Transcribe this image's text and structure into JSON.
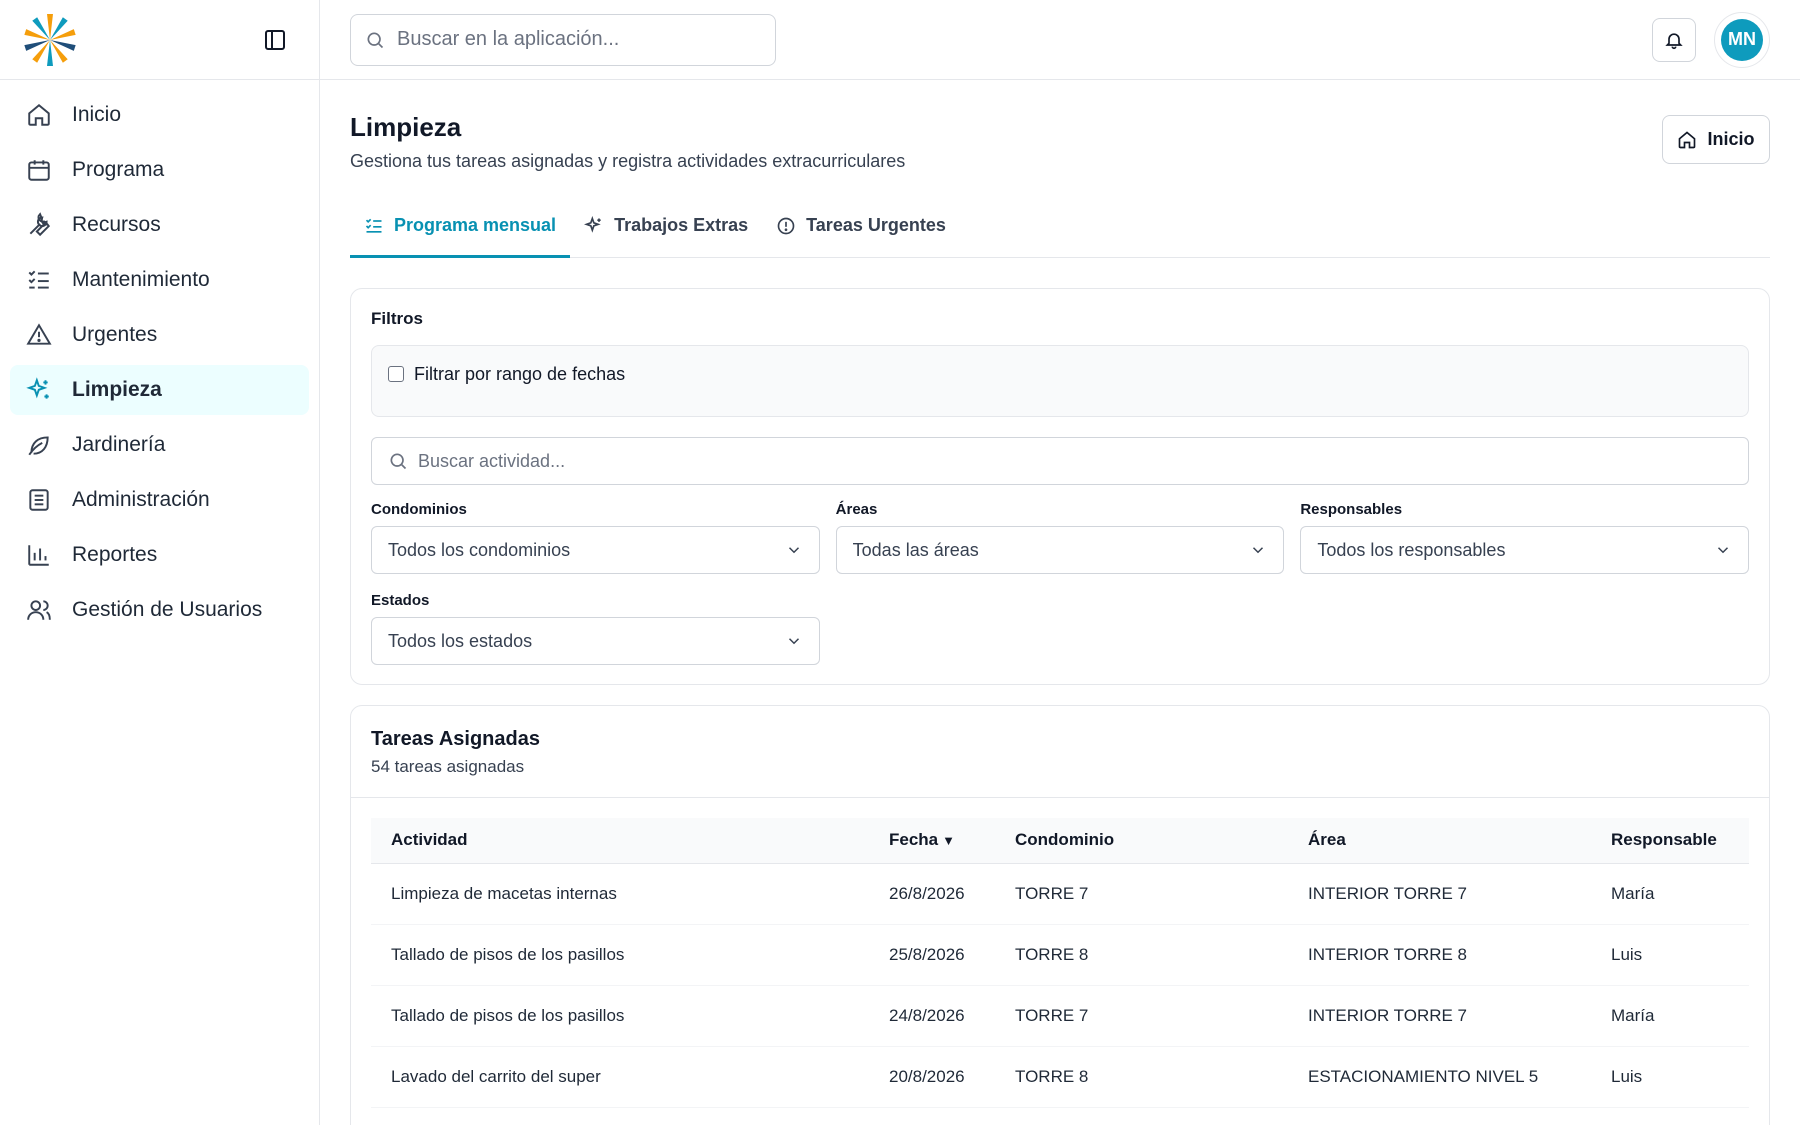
{
  "sidebar": {
    "items": [
      {
        "label": "Inicio"
      },
      {
        "label": "Programa"
      },
      {
        "label": "Recursos"
      },
      {
        "label": "Mantenimiento"
      },
      {
        "label": "Urgentes"
      },
      {
        "label": "Limpieza"
      },
      {
        "label": "Jardinería"
      },
      {
        "label": "Administración"
      },
      {
        "label": "Reportes"
      },
      {
        "label": "Gestión de Usuarios"
      }
    ],
    "active_item": "Limpieza"
  },
  "topbar": {
    "search_placeholder": "Buscar en la aplicación...",
    "avatar_initials": "MN"
  },
  "page": {
    "title": "Limpieza",
    "subtitle": "Gestiona tus tareas asignadas y registra actividades extracurriculares",
    "home_button": "Inicio"
  },
  "tabs": [
    {
      "label": "Programa mensual",
      "active": true
    },
    {
      "label": "Trabajos Extras",
      "active": false
    },
    {
      "label": "Tareas Urgentes",
      "active": false
    }
  ],
  "filters": {
    "title": "Filtros",
    "date_range_label": "Filtrar por rango de fechas",
    "search_placeholder": "Buscar actividad...",
    "condominios": {
      "label": "Condominios",
      "value": "Todos los condominios"
    },
    "areas": {
      "label": "Áreas",
      "value": "Todas las áreas"
    },
    "responsables": {
      "label": "Responsables",
      "value": "Todos los responsables"
    },
    "estados": {
      "label": "Estados",
      "value": "Todos los estados"
    }
  },
  "tasks": {
    "title": "Tareas Asignadas",
    "count_text": "54 tareas asignadas",
    "columns": [
      "Actividad",
      "Fecha",
      "Condominio",
      "Área",
      "Responsable"
    ],
    "sort_indicator": "▼",
    "rows": [
      [
        "Limpieza de macetas internas",
        "26/8/2026",
        "TORRE 7",
        "INTERIOR TORRE 7",
        "María"
      ],
      [
        "Tallado de pisos de los pasillos",
        "25/8/2026",
        "TORRE 8",
        "INTERIOR TORRE 8",
        "Luis"
      ],
      [
        "Tallado de pisos de los pasillos",
        "24/8/2026",
        "TORRE 7",
        "INTERIOR TORRE 7",
        "María"
      ],
      [
        "Lavado del carrito del super",
        "20/8/2026",
        "TORRE 8",
        "ESTACIONAMIENTO NIVEL 5",
        "Luis"
      ]
    ]
  },
  "colors": {
    "accent": "#0891b2",
    "active_bg": "#ecfeff",
    "avatar_bg": "#0e9bbd"
  }
}
